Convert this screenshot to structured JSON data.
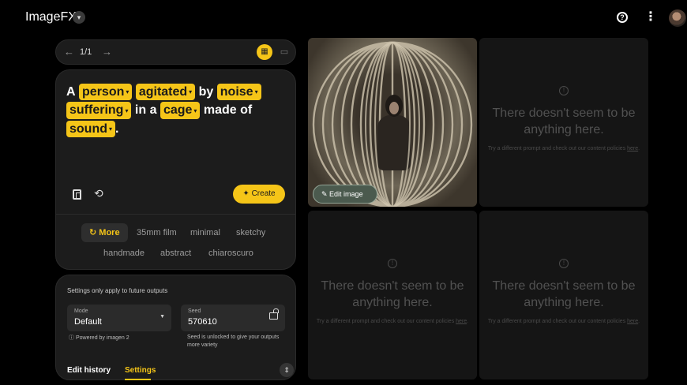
{
  "app": {
    "name": "ImageFX"
  },
  "nav": {
    "counter": "1/1"
  },
  "prompt": {
    "parts": [
      {
        "text": "A",
        "chip": false
      },
      {
        "text": "person",
        "chip": true
      },
      {
        "text": "agitated",
        "chip": true
      },
      {
        "text": "by",
        "chip": false
      },
      {
        "text": "noise",
        "chip": true
      },
      {
        "text": "suffering",
        "chip": true
      },
      {
        "text": "in a",
        "chip": false
      },
      {
        "text": "cage",
        "chip": true
      },
      {
        "text": "made of",
        "chip": false
      },
      {
        "text": "sound",
        "chip": true
      },
      {
        "text": ".",
        "chip": false
      }
    ]
  },
  "actions": {
    "create_label": "Create"
  },
  "styles": {
    "more_label": "More",
    "items": [
      "35mm film",
      "minimal",
      "sketchy",
      "handmade",
      "abstract",
      "chiaroscuro"
    ]
  },
  "settings": {
    "note": "Settings only apply to future outputs",
    "mode": {
      "label": "Mode",
      "value": "Default",
      "powered_by": "Powered by imagen 2"
    },
    "seed": {
      "label": "Seed",
      "value": "570610",
      "note": "Seed is unlocked to give your outputs more variety"
    },
    "tabs": [
      "Edit history",
      "Settings"
    ],
    "active_tab": "Settings"
  },
  "image_tile": {
    "edit_label": "Edit image"
  },
  "empty_state": {
    "title": "There doesn't seem to be anything here.",
    "subtitle_prefix": "Try a different prompt and check out our content policies ",
    "link": "here",
    "suffix": "."
  },
  "colors": {
    "accent": "#f5c518",
    "background": "#000000",
    "card": "#1c1c1c"
  }
}
